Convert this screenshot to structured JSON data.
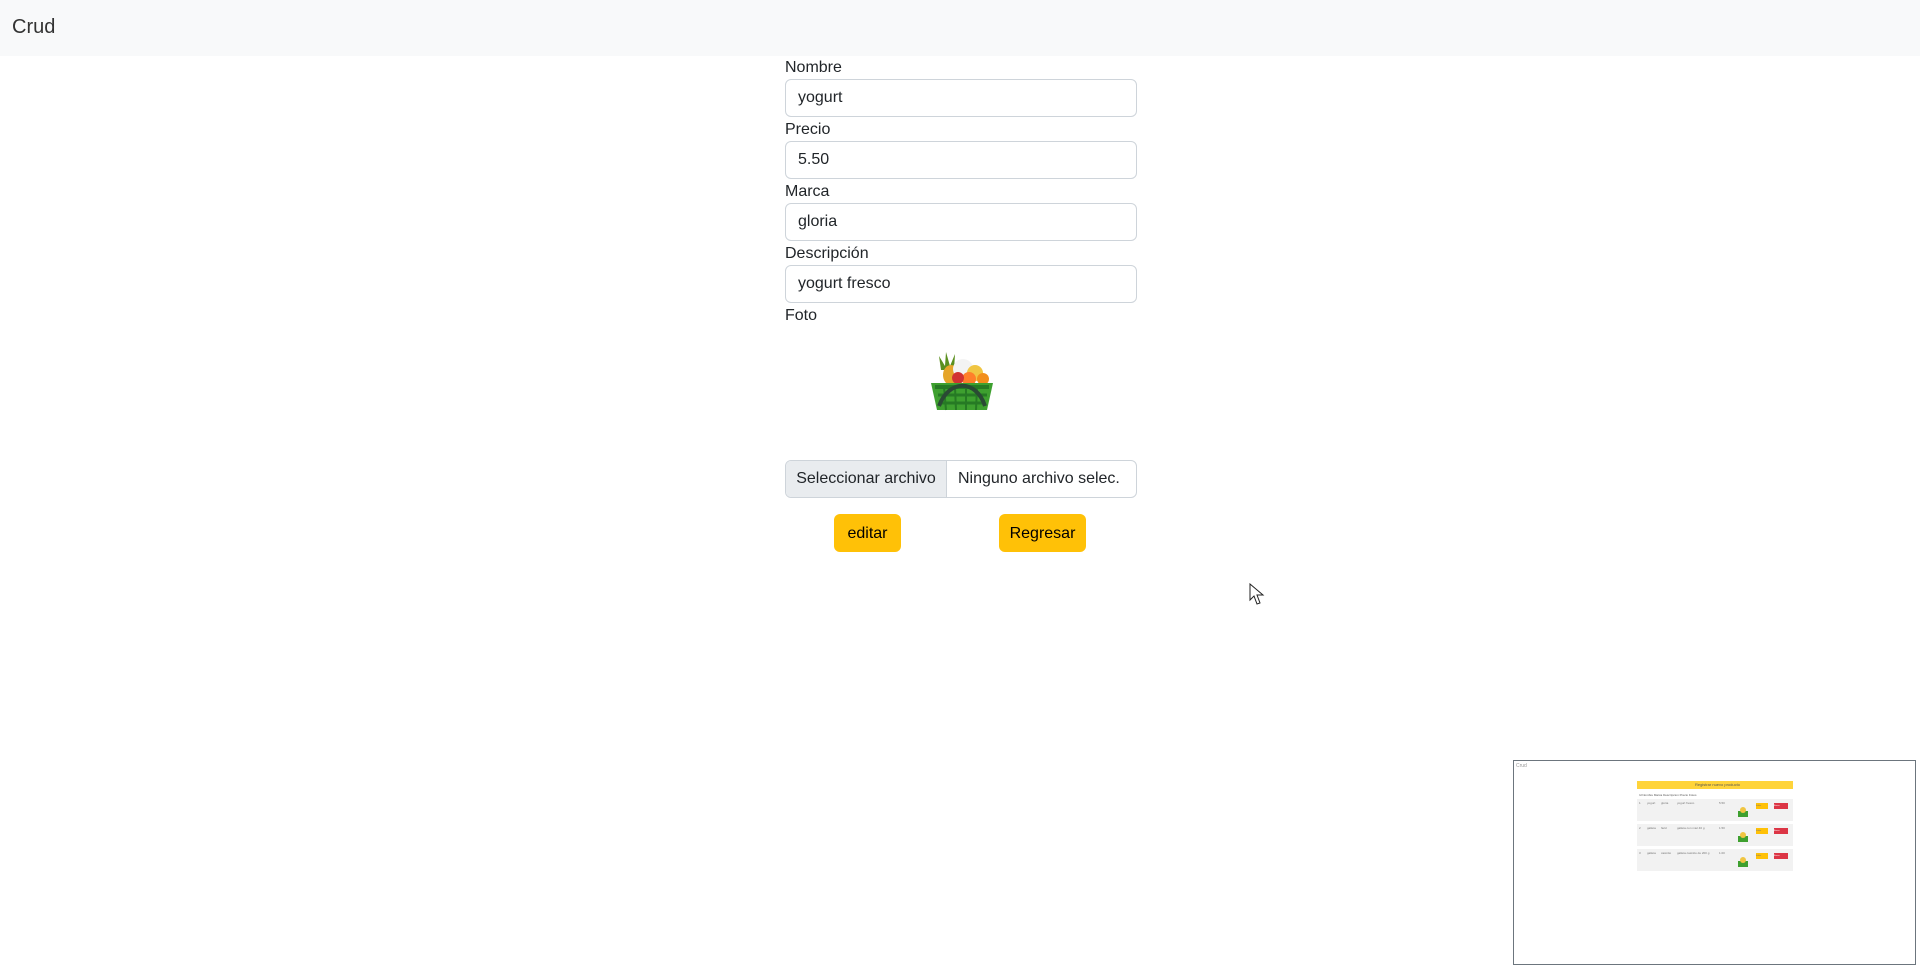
{
  "navbar": {
    "brand": "Crud"
  },
  "form": {
    "fields": [
      {
        "label": "Nombre",
        "value": "yogurt"
      },
      {
        "label": "Precio",
        "value": "5.50"
      },
      {
        "label": "Marca",
        "value": "gloria"
      },
      {
        "label": "Descripción",
        "value": "yogurt fresco"
      }
    ],
    "photo_label": "Foto",
    "photo_icon": "fruit-basket-icon",
    "file_button": "Seleccionar archivo",
    "file_status": "Ninguno archivo selec.",
    "edit_button": "editar",
    "back_button": "Regresar"
  },
  "thumbnail": {
    "title": "Crud",
    "header": "Registrar nuevo producto",
    "columns": [
      "Id",
      "Nombre",
      "Marca",
      "Descripcion",
      "Precio",
      "Fotos"
    ],
    "rows": [
      [
        "1",
        "yogurt",
        "gloria",
        "yogurt fresco",
        "5.50"
      ],
      [
        "2",
        "galleta",
        "field",
        "galleta con miel 40 g",
        "1.50"
      ],
      [
        "3",
        "galleta",
        "casinito",
        "galleta casinito de 200 g",
        "1.00"
      ]
    ],
    "edit_label": "Editar",
    "delete_label": "Borrar"
  },
  "colors": {
    "accent": "#ffc107",
    "danger": "#dc3545",
    "navbar": "#f8f9fa"
  }
}
